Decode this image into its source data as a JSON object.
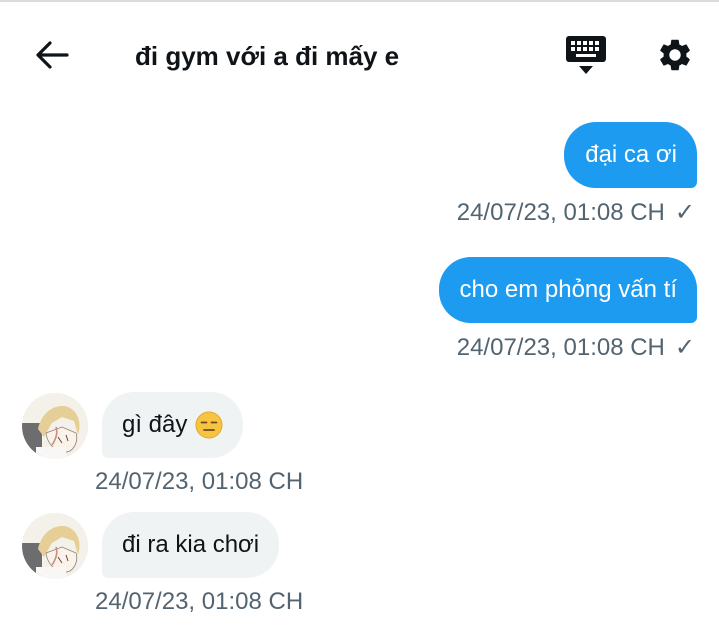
{
  "header": {
    "title": "đi gym với a đi mấy e",
    "back_icon": "arrow-left-icon",
    "keyboard_icon": "keyboard-icon",
    "settings_icon": "gear-icon"
  },
  "messages": [
    {
      "direction": "outgoing",
      "text": "đại ca ơi",
      "time": "24/07/23, 01:08 CH",
      "status": "✓"
    },
    {
      "direction": "outgoing",
      "text": "cho em phỏng vấn tí",
      "time": "24/07/23, 01:08 CH",
      "status": "✓"
    },
    {
      "direction": "incoming",
      "text": "gì đây",
      "emoji": "expressionless-face",
      "time": "24/07/23, 01:08 CH"
    },
    {
      "direction": "incoming",
      "text": "đi ra kia chơi",
      "time": "24/07/23, 01:08 CH"
    }
  ],
  "colors": {
    "outgoing_bubble": "#1d9bf0",
    "incoming_bubble": "#eff3f4",
    "meta_text": "#536471"
  }
}
